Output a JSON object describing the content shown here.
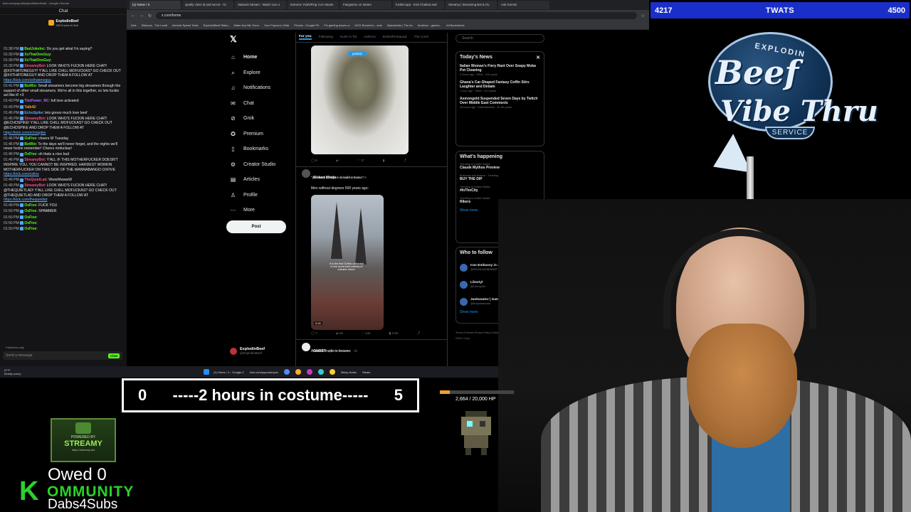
{
  "chat": {
    "window_title": "kick.com/popout/explodinbeef/chat - Google Chrome",
    "header": "Chat",
    "pinned_name": "ExplodinBeef",
    "pinned_sub": "Gift 5 subs to 5ub",
    "messages": [
      {
        "ts": "01:38 PM",
        "user": "BadJokeInc",
        "color": "#53fc18",
        "text": "Do you get what I'm saying?"
      },
      {
        "ts": "01:39 PM",
        "user": "XxThatOneGuy",
        "color": "#53fc18",
        "text": ""
      },
      {
        "ts": "01:39 PM",
        "user": "XxThatOneGuy",
        "color": "#53fc18",
        "text": ""
      },
      {
        "ts": "01:39 PM",
        "user": "StreamyBot",
        "color": "#ff4d7d",
        "text": "LOOK WHO'S FUCKIN HERE CHAT! @XXTHATONEGUY! Y'ALL LIKE CHILL MOFUCKAS? GO CHECK OUT @XXTHATONEGUY AND DROP THEM A FOLLOW AT ",
        "link": "https://kick.com/xxthatoneguy"
      },
      {
        "ts": "01:41 PM",
        "user": "BotRix",
        "color": "#53fc18",
        "text": "Small streamers become big streamers through the support of other small streamers. We're all in this together, so lets fuckin act like it! <3"
      },
      {
        "ts": "01:43 PM",
        "user": "TiioPower_RC",
        "color": "#b26bff",
        "text": "full love activated"
      },
      {
        "ts": "01:43 PM",
        "user": "Talb42",
        "color": "#f5a623",
        "text": ""
      },
      {
        "ts": "01:45 PM",
        "user": "EchoSpike",
        "color": "#53a7ff",
        "text": "lets goooo much love beef"
      },
      {
        "ts": "01:45 PM",
        "user": "StreamyBot",
        "color": "#ff4d7d",
        "text": "LOOK WHO'S FUCKIN HERE CHAT! @ECHOSPIKE! Y'ALL LIKE CHILL MOFUCKAS? GO CHECK OUT @ECHOSPIKE AND DROP THEM A FOLLOW AT ",
        "link": "https://kick.com/echospike"
      },
      {
        "ts": "01:46 PM",
        "user": "OxFive",
        "color": "#53fc18",
        "text": "cheers W Tuesday"
      },
      {
        "ts": "01:46 PM",
        "user": "BotRix",
        "color": "#53fc18",
        "text": "To the days we'll never forget, and the nights we'll never fuckin remember! Cheers mofuckas!"
      },
      {
        "ts": "01:46 PM",
        "user": "OxFive",
        "color": "#53fc18",
        "text": "oh thats a nice bud"
      },
      {
        "ts": "01:46 PM",
        "user": "StreamyBot",
        "color": "#ff4d7d",
        "text": "Y'ALL IF THIS MOTHERFUCKER DOESN'T INSPIRE YOU, YOU CANNOT BE INSPIRED. HARDEST WORKIN MOTHERFUCKER ON THIS SIDE OF THE WANNABANGO OXFIVE ",
        "link": "https://kick.com/oxfive"
      },
      {
        "ts": "01:49 PM",
        "user": "TheQuietLad",
        "color": "#ff4d7d",
        "text": "WwwWwwwW"
      },
      {
        "ts": "01:49 PM",
        "user": "StreamyBot",
        "color": "#ff4d7d",
        "text": "LOOK WHO'S FUCKIN HERE CHAT! @THEQUIETLAD! Y'ALL LIKE CHILL MOFUCKAS? GO CHECK OUT @THEQUIETLAD AND DROP THEM A FOLLOW AT ",
        "link": "https://kick.com/thequietlad"
      },
      {
        "ts": "01:49 PM",
        "user": "OxFive",
        "color": "#53fc18",
        "text": "FUCK YOU"
      },
      {
        "ts": "01:50 PM",
        "user": "OxFive",
        "color": "#53fc18",
        "text": "SPAMMER"
      },
      {
        "ts": "01:50 PM",
        "user": "OxFive",
        "color": "#53fc18",
        "text": ""
      },
      {
        "ts": "01:50 PM",
        "user": "OxFive",
        "color": "#53fc18",
        "text": ""
      },
      {
        "ts": "01:50 PM",
        "user": "OxFive",
        "color": "#53fc18",
        "text": ""
      }
    ],
    "follow_note": "Followers only",
    "input_placeholder": "Send a message",
    "send_label": "Chat"
  },
  "browser": {
    "tabs": [
      "(1) Home / X",
      "spotify client id and secret - Gi",
      "Station5 Stream - Watch Live o",
      "Extreme Yoshi/Ping 3 on Steam",
      "Fangstone on Steam",
      "Kicklet.app - Kick Chatbot and",
      "Streamy | Streaming Bot & Ov",
      "Ask Gemini"
    ],
    "url": "x.com/home",
    "bookmarks": [
      "Kick",
      "Dislocus - The Leadi",
      "Internet Speed Tests",
      "ExplodinBeef Stats |",
      "Make Any Mic Soun",
      "Your Popcorn | Web",
      "Photos - Google Ph",
      "Fix gaming issues w",
      "KICK Boombox - auto",
      "Mykesiants | The be",
      "Ambivox - games -",
      "All Bookmarks"
    ]
  },
  "x": {
    "nav": [
      {
        "label": "Home",
        "icon": "home-icon",
        "glyph": "⌂",
        "bold": true
      },
      {
        "label": "Explore",
        "icon": "search-icon",
        "glyph": "⌕"
      },
      {
        "label": "Notifications",
        "icon": "bell-icon",
        "glyph": "♫"
      },
      {
        "label": "Chat",
        "icon": "chat-icon",
        "glyph": "✉"
      },
      {
        "label": "Grok",
        "icon": "grok-icon",
        "glyph": "⊘"
      },
      {
        "label": "Premium",
        "icon": "premium-icon",
        "glyph": "✪"
      },
      {
        "label": "Bookmarks",
        "icon": "bookmark-icon",
        "glyph": "▯"
      },
      {
        "label": "Creator Studio",
        "icon": "creator-icon",
        "glyph": "⚙"
      },
      {
        "label": "Articles",
        "icon": "article-icon",
        "glyph": "▤"
      },
      {
        "label": "Profile",
        "icon": "profile-icon",
        "glyph": "♙"
      },
      {
        "label": "More",
        "icon": "more-icon",
        "glyph": "⋯"
      }
    ],
    "post_label": "Post",
    "account_name": "ExplodinBeef",
    "account_handle": "@ExplodinBeef",
    "feed_tabs": [
      "For you",
      "Following",
      "Kush Is Tst",
      "Authors",
      "BotsNPixSquad",
      "The Comi"
    ],
    "posted_pill": "posted",
    "tweet1_actions": [
      "6",
      "",
      "17",
      "",
      ""
    ],
    "tweet2": {
      "name": "Woken Minds",
      "handle": "@wokenminds · 3h",
      "quote": "\"you need a degree to build a house\"",
      "text": "Men without degrees 500 years ago:",
      "caption": "It is the first Gothic cathedral in the world built entirely of volcanic stone.",
      "video_time": "0:00",
      "actions": [
        "7",
        "25",
        "144",
        "3.3K",
        ""
      ]
    },
    "tweet3": {
      "name": "GHOST",
      "handle": "@GhostTweets · 3h",
      "text": "A match made in heaven"
    },
    "search_placeholder": "Search",
    "news_title": "Today's News",
    "news": [
      {
        "headline": "Italian Woman's Fiery Rant Over Soapy Moka Pot Cleaning",
        "meta": "2 hours ago · Other · 416 posts"
      },
      {
        "headline": "Ghana's Car-Shaped Fantasy Coffin Stirs Laughter and Debate",
        "meta": "1 hour ago · Other · 412 posts"
      },
      {
        "headline": "Asmongold Suspended Seven Days by Twitch Over Middle East Comments",
        "meta": "16 hours ago · Entertainment · 81.6K posts"
      }
    ],
    "happening_title": "What's happening",
    "trends": [
      {
        "context": "Trending in United States",
        "topic": "Claude Mythos Preview"
      },
      {
        "context": "Business and finance · Trending",
        "topic": "BUY THE DIP"
      },
      {
        "context": "Trending in United States",
        "topic": "#InTheCity"
      },
      {
        "context": "Trending in United States",
        "topic": "Rikers"
      }
    ],
    "show_more": "Show more",
    "wtf_title": "Who to follow",
    "wtf": [
      {
        "name": "Iran Embassy in Zim...",
        "handle": "@IRANinZIMBABWE",
        "btn": "Follow"
      },
      {
        "name": "Libertyl",
        "handle": "@Libertylen",
        "btn": "Follow"
      },
      {
        "name": "Jankanator | Gamin...",
        "handle": "@thejankanator",
        "btn": "Follow"
      }
    ],
    "footer": "Terms of Service  Privacy Policy  Cookie Policy  Accessibility  Ads info  More ...  © 2026 X Corp."
  },
  "taskbar": {
    "weather_temp": "67°F",
    "weather_desc": "Mostly sunny",
    "apps": [
      "(1) Home / X - Google C",
      "kick.com/popout/explo",
      "",
      "",
      "",
      "",
      "",
      "Sticky Notes",
      "Steam"
    ],
    "time": "3:50 PM",
    "date": "4/7/2026"
  },
  "overlay": {
    "left_count": "4217",
    "center_label": "TWATS",
    "right_count": "4500",
    "logo_top": "EXPLODIN",
    "logo_beef": "Beef",
    "logo_vibe": "Vibe Thru",
    "logo_service": "SERVICE",
    "subgoal_left": "0",
    "subgoal_text": "-----2 hours in costume-----",
    "subgoal_right": "5",
    "hp_text": "2,664 / 20,000 HP",
    "hp_fraction": 0.133,
    "powered_by": "POWERED BY",
    "streamy": "STREAMY",
    "streamy_url": "https://streamy.bot",
    "owed": "Owed 0",
    "k_letter": "K",
    "community": "OMMUNITY",
    "dabs": "Dabs4Subs"
  },
  "colors": {
    "kick_green": "#53fc18",
    "x_blue": "#1d9bf0",
    "topbar_blue": "#1a2fc9",
    "community_green": "#2bd12b",
    "hp_orange": "#f0a02a"
  }
}
